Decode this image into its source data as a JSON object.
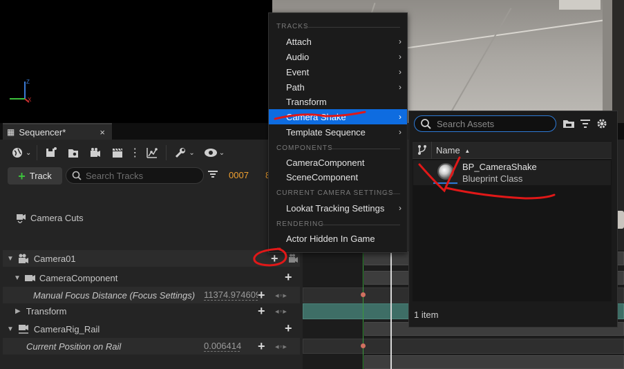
{
  "sequencer": {
    "tab_title": "Sequencer*",
    "close_glyph": "×",
    "track_button_label": "Track",
    "search_tracks_placeholder": "Search Tracks",
    "frame_number": "0007",
    "frame_number_partial": "8"
  },
  "outliner": {
    "camera_cuts": "Camera Cuts",
    "camera01": "Camera01",
    "camera_component": "CameraComponent",
    "manual_focus": {
      "label": "Manual Focus Distance (Focus Settings)",
      "value": "11374.974609"
    },
    "transform": "Transform",
    "camera_rig_rail": "CameraRig_Rail",
    "current_position": {
      "label": "Current Position on Rail",
      "value": "0.006414"
    }
  },
  "menu": {
    "sections": {
      "tracks": "TRACKS",
      "components": "COMPONENTS",
      "current_camera_settings": "CURRENT CAMERA SETTINGS",
      "rendering": "RENDERING"
    },
    "items": {
      "attach": "Attach",
      "audio": "Audio",
      "event": "Event",
      "path": "Path",
      "transform": "Transform",
      "camera_shake": "Camera Shake",
      "template_sequence": "Template Sequence",
      "camera_component": "CameraComponent",
      "scene_component": "SceneComponent",
      "lookat_tracking": "Lookat Tracking Settings",
      "actor_hidden": "Actor Hidden In Game"
    }
  },
  "asset_picker": {
    "search_placeholder": "Search Assets",
    "column_name": "Name",
    "sort_glyph": "▲",
    "asset_name": "BP_CameraShake",
    "asset_type": "Blueprint Class",
    "item_count": "1 item"
  },
  "colors": {
    "selection_blue": "#0e6ce0",
    "annotation_red": "#e01818",
    "frame_orange": "#f0a030",
    "add_green": "#3cc13c"
  }
}
